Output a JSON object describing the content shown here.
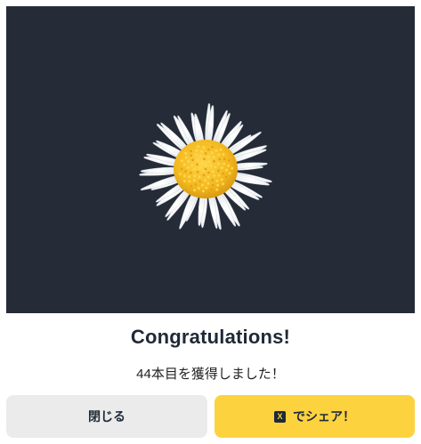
{
  "hero": {
    "image_name": "daisy-flower",
    "background_color": "#252c37",
    "petal_color": "#ffffff",
    "center_color": "#f6c12f"
  },
  "dialog": {
    "title": "Congratulations!",
    "message": "44本目を獲得しました！"
  },
  "buttons": {
    "close_label": "閉じる",
    "share_label": "でシェア！",
    "share_icon": "x-logo-icon",
    "share_icon_glyph": "X",
    "close_color": "#ebebeb",
    "share_color": "#fdd23f"
  }
}
